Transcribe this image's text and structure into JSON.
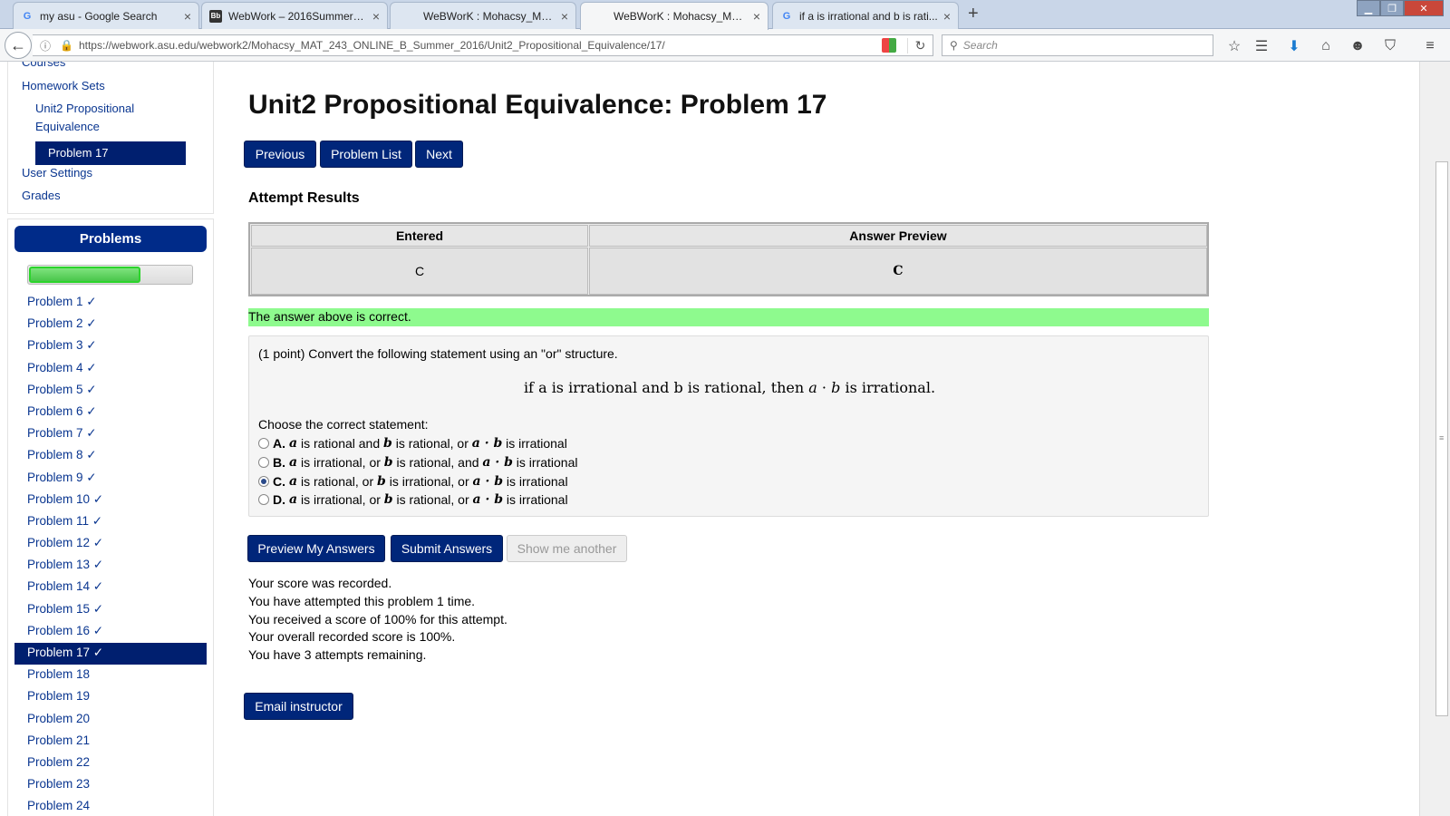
{
  "browser": {
    "tabs": [
      {
        "title": "my asu - Google Search",
        "icon": "google-icon"
      },
      {
        "title": "WebWork – 2016SummerB...",
        "icon": "blackboard-icon"
      },
      {
        "title": "WeBWorK : Mohacsy_MAT...",
        "icon": "none"
      },
      {
        "title": "WeBWorK : Mohacsy_MAT...",
        "icon": "none",
        "active": true
      },
      {
        "title": "if a is irrational and b is rati...",
        "icon": "google-icon"
      }
    ],
    "url": "https://webwork.asu.edu/webwork2/Mohacsy_MAT_243_ONLINE_B_Summer_2016/Unit2_Propositional_Equivalence/17/",
    "search_placeholder": "Search"
  },
  "sitenav": {
    "courses": "Courses",
    "homework_sets": "Homework Sets",
    "set_name_line1": "Unit2 Propositional",
    "set_name_line2": "Equivalence",
    "current_problem": "Problem 17",
    "user_settings": "User Settings",
    "grades": "Grades"
  },
  "problems_panel": {
    "header": "Problems",
    "progress_fraction": 0.68,
    "items": [
      {
        "label": "Problem 1 ✓"
      },
      {
        "label": "Problem 2 ✓"
      },
      {
        "label": "Problem 3 ✓"
      },
      {
        "label": "Problem 4 ✓"
      },
      {
        "label": "Problem 5 ✓"
      },
      {
        "label": "Problem 6 ✓"
      },
      {
        "label": "Problem 7 ✓"
      },
      {
        "label": "Problem 8 ✓"
      },
      {
        "label": "Problem 9 ✓"
      },
      {
        "label": "Problem 10 ✓"
      },
      {
        "label": "Problem 11 ✓"
      },
      {
        "label": "Problem 12 ✓"
      },
      {
        "label": "Problem 13 ✓"
      },
      {
        "label": "Problem 14 ✓"
      },
      {
        "label": "Problem 15 ✓"
      },
      {
        "label": "Problem 16 ✓"
      },
      {
        "label": "Problem 17 ✓",
        "current": true
      },
      {
        "label": "Problem 18"
      },
      {
        "label": "Problem 19"
      },
      {
        "label": "Problem 20"
      },
      {
        "label": "Problem 21"
      },
      {
        "label": "Problem 22"
      },
      {
        "label": "Problem 23"
      },
      {
        "label": "Problem 24"
      }
    ]
  },
  "main": {
    "title": "Unit2 Propositional Equivalence: Problem 17",
    "nav_buttons": {
      "previous": "Previous",
      "problem_list": "Problem List",
      "next": "Next"
    },
    "attempt_heading": "Attempt Results",
    "results": {
      "col_entered": "Entered",
      "col_preview": "Answer Preview",
      "entered": "C",
      "preview": "C"
    },
    "correct_message": "The answer above is correct.",
    "problem": {
      "intro": "(1 point) Convert the following statement using an \"or\" structure.",
      "statement": {
        "part1": "if a is irrational and b is rational, then ",
        "var_a": "a",
        "dot": " · ",
        "var_b": "b",
        "part2": " is irrational."
      },
      "choose_label": "Choose the correct statement:",
      "choices": [
        {
          "letter": "A.",
          "a": "a",
          "t1": "is rational and",
          "b": "b",
          "t2": "is rational, or",
          "ab": "a · b",
          "t3": "is irrational",
          "checked": false
        },
        {
          "letter": "B.",
          "a": "a",
          "t1": "is irrational, or",
          "b": "b",
          "t2": "is rational, and",
          "ab": "a · b",
          "t3": "is irrational",
          "checked": false
        },
        {
          "letter": "C.",
          "a": "a",
          "t1": "is rational, or",
          "b": "b",
          "t2": "is irrational, or",
          "ab": "a · b",
          "t3": "is irrational",
          "checked": true
        },
        {
          "letter": "D.",
          "a": "a",
          "t1": "is irrational, or",
          "b": "b",
          "t2": "is rational, or",
          "ab": "a · b",
          "t3": "is irrational",
          "checked": false
        }
      ]
    },
    "action_buttons": {
      "preview": "Preview My Answers",
      "submit": "Submit Answers",
      "show_another": "Show me another"
    },
    "score_lines": [
      "Your score was recorded.",
      "You have attempted this problem 1 time.",
      "You received a score of 100% for this attempt.",
      "Your overall recorded score is 100%.",
      "You have 3 attempts remaining."
    ],
    "email_button": "Email instructor"
  }
}
